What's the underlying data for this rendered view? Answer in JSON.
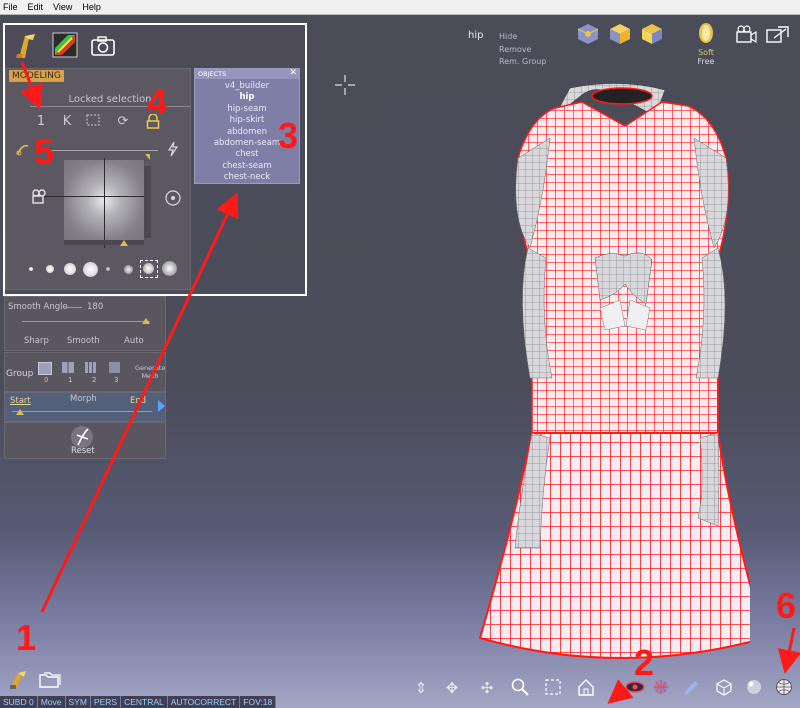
{
  "menu": [
    "File",
    "Edit",
    "View",
    "Help"
  ],
  "panel": {
    "tab_label": "MODELING",
    "locked_selection": "Locked selection",
    "objects_header": "OBJECTS",
    "objects_close": "✕",
    "objects": [
      "v4_builder",
      "hip",
      "hip-seam",
      "hip-skirt",
      "abdomen",
      "abdomen-seam",
      "chest",
      "chest-seam",
      "chest-neck"
    ],
    "selected_object": "hip"
  },
  "smooth": {
    "label": "Smooth Angle",
    "value": "180",
    "options": [
      "Sharp",
      "Smooth",
      "Auto"
    ]
  },
  "group": {
    "label": "Group",
    "levels": [
      "0",
      "1",
      "2",
      "3"
    ],
    "generate": "Generate Mesh"
  },
  "morph": {
    "start": "Start",
    "label": "Morph",
    "end": "End"
  },
  "reset": {
    "label": "Reset"
  },
  "viewport": {
    "selected": "hip",
    "hide": "Hide",
    "remove": "Remove",
    "rem_group": "Rem. Group",
    "soft": "Soft",
    "free": "Free",
    "accent_color": "#ff1a1a"
  },
  "status": [
    "SUBD 0",
    "Move",
    "SYM",
    "PERS",
    "CENTRAL",
    "AUTOCORRECT",
    "FOV:18"
  ],
  "annotations": {
    "a1": "1",
    "a2": "2",
    "a3": "3",
    "a4": "4",
    "a5": "5",
    "a6": "6"
  }
}
